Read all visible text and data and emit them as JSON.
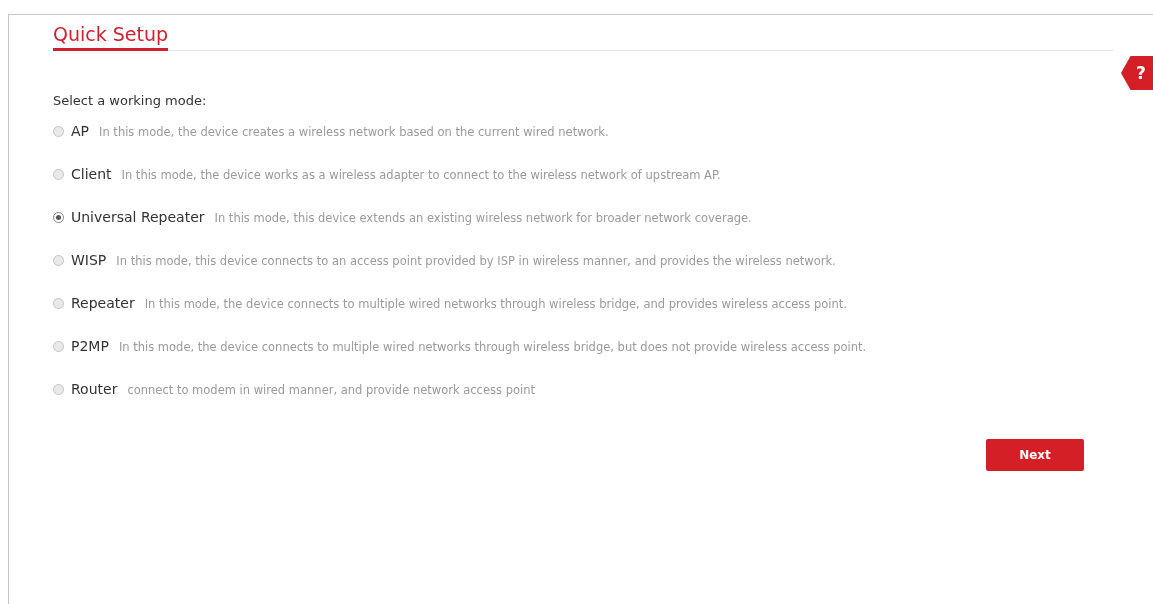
{
  "title": "Quick Setup",
  "prompt": "Select a working mode:",
  "modes": [
    {
      "name": "AP",
      "description": "In this mode, the device creates a wireless network based on the current wired network.",
      "selected": false
    },
    {
      "name": "Client",
      "description": "In this mode, the device works as a wireless adapter to connect to the wireless network of upstream AP.",
      "selected": false
    },
    {
      "name": "Universal Repeater",
      "description": "In this mode, this device extends an existing wireless network for broader network coverage.",
      "selected": true
    },
    {
      "name": "WISP",
      "description": "In this mode, this device connects to an access point provided by ISP in wireless manner, and provides the wireless network.",
      "selected": false
    },
    {
      "name": "Repeater",
      "description": "In this mode, the device connects to multiple wired networks through wireless bridge, and provides wireless access point.",
      "selected": false
    },
    {
      "name": "P2MP",
      "description": "In this mode, the device connects to multiple wired networks through wireless bridge, but does not provide wireless access point.",
      "selected": false
    },
    {
      "name": "Router",
      "description": "connect to modem in wired manner, and provide network access point",
      "selected": false
    }
  ],
  "help": "?",
  "next_button": "Next"
}
